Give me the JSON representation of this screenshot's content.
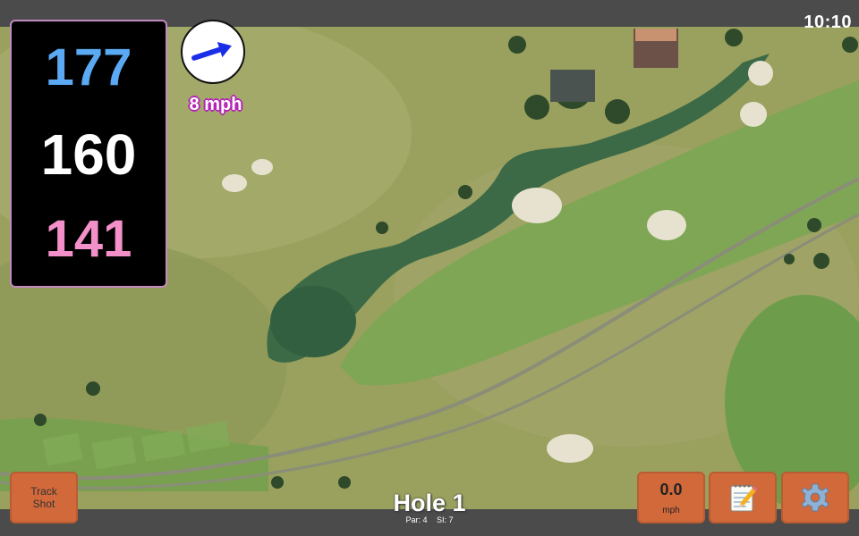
{
  "status": {
    "clock": "10:10"
  },
  "distances": {
    "back": "177",
    "middle": "160",
    "front": "141"
  },
  "wind": {
    "speed_label": "8 mph",
    "icon": "wind-arrow-icon"
  },
  "buttons": {
    "track_shot_line1": "Track",
    "track_shot_line2": "Shot",
    "speed_value": "0.0",
    "speed_unit": "mph",
    "notes_icon": "notepad-icon",
    "settings_icon": "gear-icon"
  },
  "hole": {
    "title": "Hole 1",
    "par": "Par: 4",
    "si": "SI: 7"
  },
  "colors": {
    "back": "#5aa9f2",
    "middle": "#ffffff",
    "front": "#f490c9",
    "button": "#d2693b",
    "accent": "#b425b4"
  }
}
